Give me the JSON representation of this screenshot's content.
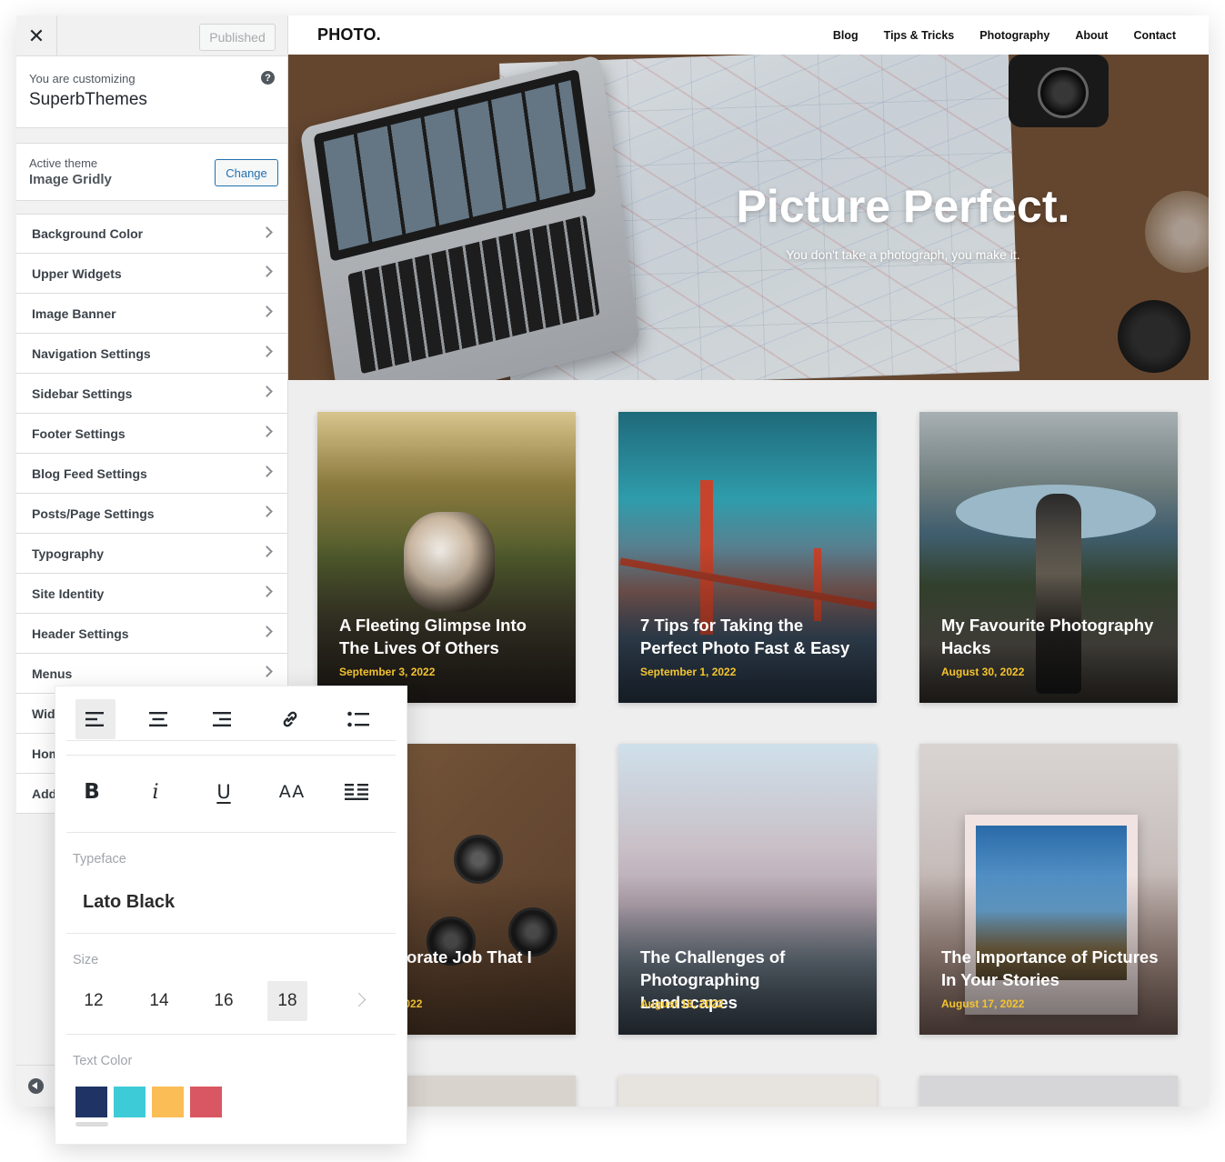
{
  "customizer": {
    "close_label": "✕",
    "publish_label": "Published",
    "info_sub": "You are customizing",
    "info_title": "SuperbThemes",
    "help_label": "?",
    "theme_sub": "Active theme",
    "theme_name": "Image Gridly",
    "change_label": "Change",
    "items": [
      "Background Color",
      "Upper Widgets",
      "Image Banner",
      "Navigation Settings",
      "Sidebar Settings",
      "Footer Settings",
      "Blog Feed Settings",
      "Posts/Page Settings",
      "Typography",
      "Site Identity",
      "Header Settings",
      "Menus",
      "Widgets",
      "Homepage Settings",
      "Additional CSS"
    ]
  },
  "site": {
    "logo": "PHOTO.",
    "nav": [
      "Blog",
      "Tips & Tricks",
      "Photography",
      "About",
      "Contact"
    ],
    "hero_title": "Picture Perfect.",
    "hero_sub": "You don't take a photograph, you make it.",
    "posts": [
      {
        "title": "A Fleeting Glimpse Into The Lives Of Others",
        "date": "September 3, 2022"
      },
      {
        "title": "7 Tips for Taking the Perfect Photo Fast & Easy",
        "date": "September 1, 2022"
      },
      {
        "title": "My Favourite Photography Hacks",
        "date": "August 30, 2022"
      },
      {
        "title": "My Corporate Job That I Love",
        "date": "August 22, 2022"
      },
      {
        "title": "The Challenges of Photographing Landscapes",
        "date": "August 18, 2022"
      },
      {
        "title": "The Importance of Pictures In Your Stories",
        "date": "August 17, 2022"
      }
    ]
  },
  "panel": {
    "tools_row1": [
      "align-left-icon",
      "align-center-icon",
      "align-right-icon",
      "link-icon",
      "bullet-list-icon"
    ],
    "tools_row2": [
      "bold-icon",
      "italic-icon",
      "underline-icon",
      "font-size-icon",
      "justify-icon"
    ],
    "glyph_bold": "B",
    "glyph_italic": "i",
    "glyph_underline": "U",
    "glyph_aa": "AA",
    "typeface_label": "Typeface",
    "typeface_value": "Lato Black",
    "size_label": "Size",
    "sizes": [
      "12",
      "14",
      "16",
      "18"
    ],
    "selected_size": "18",
    "text_color_label": "Text Color",
    "colors": [
      "#1f3464",
      "#3ecbd8",
      "#fbbd56",
      "#d95762"
    ]
  },
  "colors": {
    "accent_blue": "#2271b1",
    "date_yellow": "#f4c431"
  }
}
